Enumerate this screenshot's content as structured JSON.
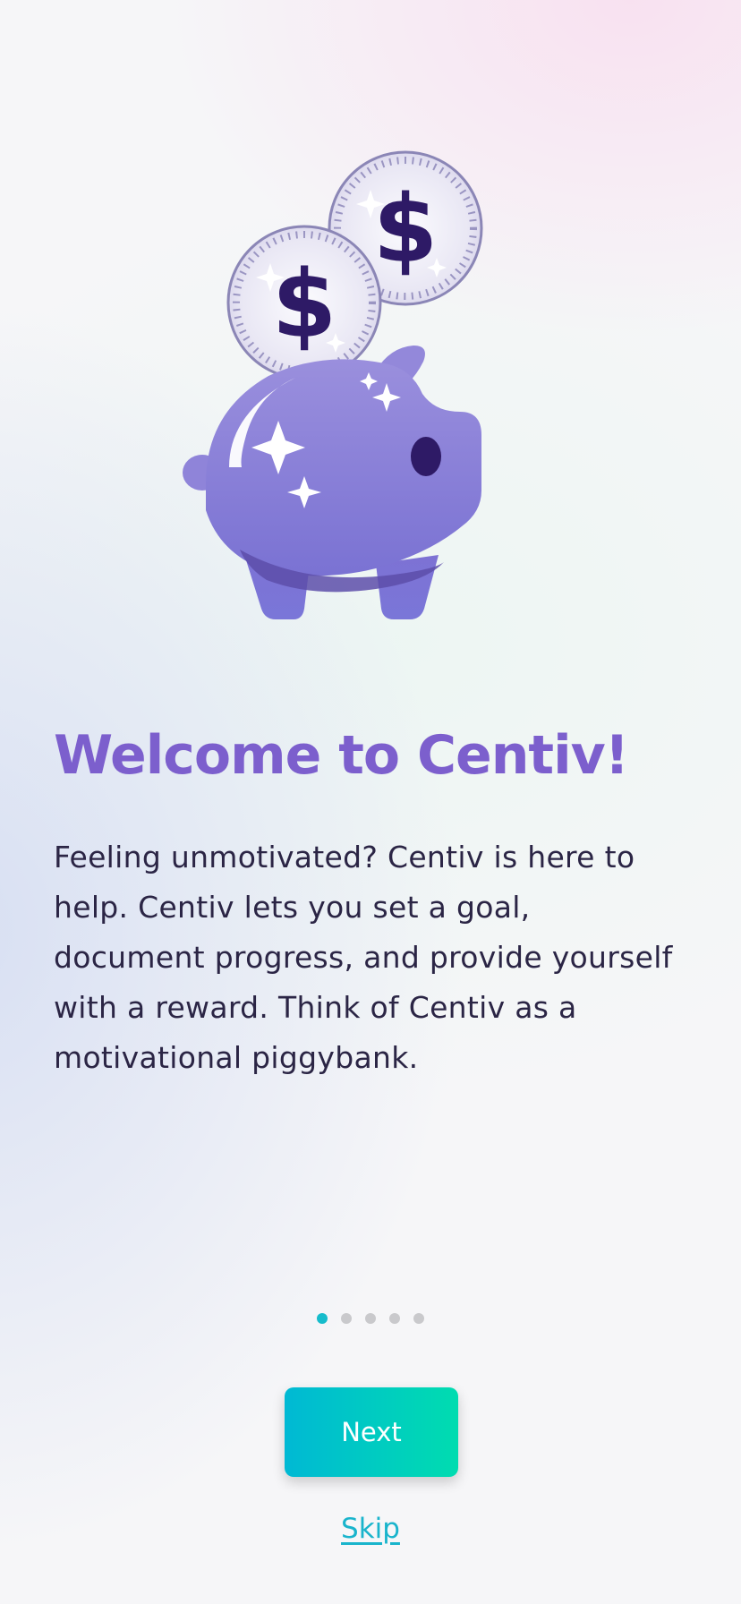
{
  "onboarding": {
    "title": "Welcome to Centiv!",
    "body": "Feeling unmotivated? Centiv is here to help. Centiv lets you set a goal, document progress, and provide yourself with a reward. Think of Centiv as a motivational piggybank.",
    "illustration": {
      "icon": "piggy-bank-with-coins-icon",
      "coin_symbol": "$"
    },
    "pagination": {
      "current_page": 1,
      "total_pages": 5
    },
    "next_label": "Next",
    "skip_label": "Skip"
  },
  "colors": {
    "title": "#7c5fcd",
    "body_text": "#2b2545",
    "accent_start": "#00b9d4",
    "accent_end": "#00dcb0",
    "dot_active": "#16bccc",
    "dot_inactive": "#c9c9cc",
    "pig": "#8b7fd8",
    "coin_symbol": "#2e1a66"
  }
}
